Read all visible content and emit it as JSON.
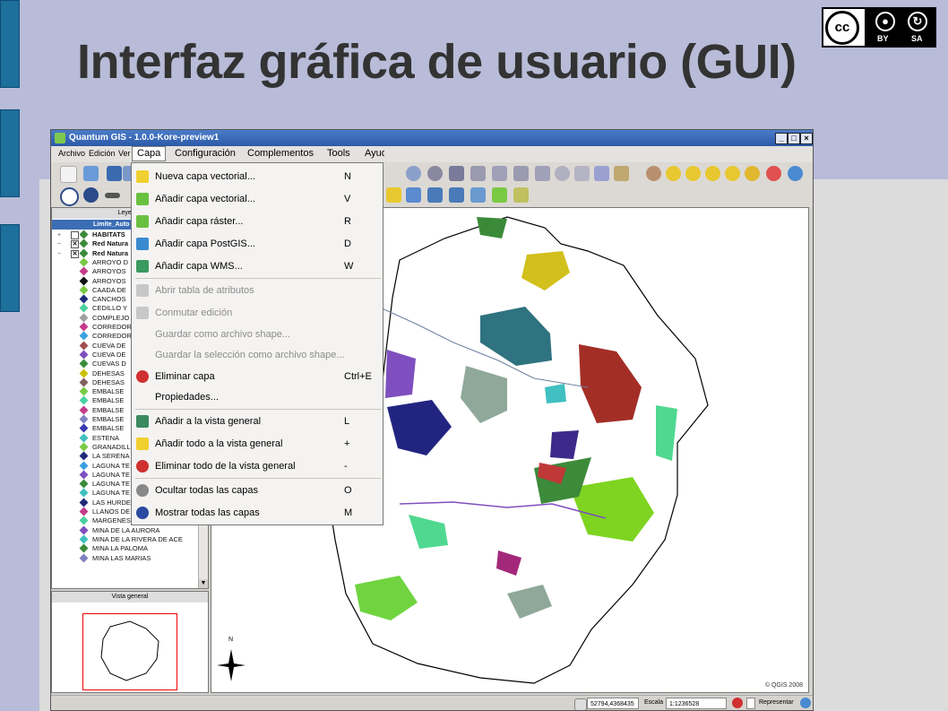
{
  "slide": {
    "title": "Interfaz gráfica de usuario (GUI)"
  },
  "license": {
    "cc": "cc",
    "labels": [
      "BY",
      "SA"
    ]
  },
  "window": {
    "title": "Quantum GIS - 1.0.0-Kore-preview1"
  },
  "menubar": {
    "items": [
      "Archivo",
      "Edición",
      "Ver",
      "Capa",
      "Configuración",
      "Complementos",
      "Tools",
      "Ayuda"
    ]
  },
  "capa_menu": {
    "items": [
      {
        "label": "Nueva capa vectorial...",
        "shortcut": "N",
        "icon": "new-vector-layer-icon",
        "enabled": true
      },
      {
        "label": "Añadir capa vectorial...",
        "shortcut": "V",
        "icon": "add-vector-layer-icon",
        "enabled": true
      },
      {
        "label": "Añadir capa ráster...",
        "shortcut": "R",
        "icon": "add-raster-layer-icon",
        "enabled": true
      },
      {
        "label": "Añadir capa PostGIS...",
        "shortcut": "D",
        "icon": "add-postgis-layer-icon",
        "enabled": true
      },
      {
        "label": "Añadir capa WMS...",
        "shortcut": "W",
        "icon": "add-wms-layer-icon",
        "enabled": true
      },
      {
        "label": "Abrir tabla de atributos",
        "shortcut": "",
        "icon": "attribute-table-icon",
        "enabled": false
      },
      {
        "label": "Conmutar edición",
        "shortcut": "",
        "icon": "toggle-edit-icon",
        "enabled": false
      },
      {
        "label": "Guardar como archivo shape...",
        "shortcut": "",
        "icon": "",
        "enabled": false
      },
      {
        "label": "Guardar la selección como archivo shape...",
        "shortcut": "",
        "icon": "",
        "enabled": false
      },
      {
        "label": "Eliminar capa",
        "shortcut": "Ctrl+E",
        "icon": "remove-layer-icon",
        "enabled": true
      },
      {
        "label": "Propiedades...",
        "shortcut": "",
        "icon": "",
        "enabled": true
      },
      {
        "label": "Añadir a la vista general",
        "shortcut": "L",
        "icon": "add-to-overview-icon",
        "enabled": true
      },
      {
        "label": "Añadir todo a la vista general",
        "shortcut": "+",
        "icon": "add-all-to-overview-icon",
        "enabled": true
      },
      {
        "label": "Eliminar todo de la vista general",
        "shortcut": "-",
        "icon": "remove-all-from-overview-icon",
        "enabled": true
      },
      {
        "label": "Ocultar todas las capas",
        "shortcut": "O",
        "icon": "hide-all-layers-icon",
        "enabled": true
      },
      {
        "label": "Mostrar todas las capas",
        "shortcut": "M",
        "icon": "show-all-layers-icon",
        "enabled": true
      }
    ]
  },
  "legend": {
    "title": "Leyenda",
    "selected_layer": "Limite_Auto",
    "layers": [
      {
        "label": "HABITATS",
        "color": "#3a8a3a",
        "top": true,
        "checked": false
      },
      {
        "label": "Red Natura",
        "color": "#3a8a3a",
        "top": true,
        "checked": true
      },
      {
        "label": "Red Natura",
        "color": "#3a8a3a",
        "top": true,
        "checked": true
      },
      {
        "label": "ARROYO D",
        "color": "#7ac943"
      },
      {
        "label": "ARROYOS",
        "color": "#c43b8c"
      },
      {
        "label": "ARROYOS",
        "color": "#111111"
      },
      {
        "label": "CAADA DE",
        "color": "#7ac943"
      },
      {
        "label": "CANCHOS",
        "color": "#1f2a78"
      },
      {
        "label": "CEDILLO Y",
        "color": "#4ad0a0"
      },
      {
        "label": "COMPLEJO",
        "color": "#a0a0a0"
      },
      {
        "label": "CORREDOR",
        "color": "#c43b8c"
      },
      {
        "label": "CORREDOR",
        "color": "#3aa0e0"
      },
      {
        "label": "CUEVA DE",
        "color": "#a05050"
      },
      {
        "label": "CUEVA DE",
        "color": "#7f4fbf"
      },
      {
        "label": "CUEVAS D",
        "color": "#3a8a3a"
      },
      {
        "label": "DEHESAS",
        "color": "#ccc000"
      },
      {
        "label": "DEHESAS",
        "color": "#806060"
      },
      {
        "label": "EMBALSE",
        "color": "#7ac943"
      },
      {
        "label": "EMBALSE",
        "color": "#4ad0a0"
      },
      {
        "label": "EMBALSE",
        "color": "#c43b8c"
      },
      {
        "label": "EMBALSE",
        "color": "#8080c0"
      },
      {
        "label": "EMBALSE",
        "color": "#3a3ab0"
      },
      {
        "label": "ESTENA",
        "color": "#40c0c0"
      },
      {
        "label": "GRANADILL",
        "color": "#7ac943"
      },
      {
        "label": "LA SERENA",
        "color": "#1f2a78"
      },
      {
        "label": "LAGUNA TE",
        "color": "#3aa0e0"
      },
      {
        "label": "LAGUNA TE",
        "color": "#7f4fbf"
      },
      {
        "label": "LAGUNA TE",
        "color": "#3a8a3a"
      },
      {
        "label": "LAGUNA TE",
        "color": "#40c0c0"
      },
      {
        "label": "LAS HURDE",
        "color": "#1f2a78"
      },
      {
        "label": "LLANOS DE BROZAS",
        "color": "#c43b8c"
      },
      {
        "label": "MARGENES DE VALDECAAS",
        "color": "#4ad0a0"
      },
      {
        "label": "MINA DE LA AURORA",
        "color": "#7f4fbf"
      },
      {
        "label": "MINA DE LA RIVERA DE ACE",
        "color": "#40c0c0"
      },
      {
        "label": "MINA LA PALOMA",
        "color": "#3a8a3a"
      },
      {
        "label": "MINA LAS MARIAS",
        "color": "#8080c0"
      }
    ]
  },
  "overview": {
    "title": "Vista general"
  },
  "map": {
    "copyright": "© QGIS 2008",
    "north": "N"
  },
  "status": {
    "coordinates": "52794,4368435",
    "scale_label": "Escala",
    "scale_value": "1:1236528",
    "render_label": "Representar"
  }
}
